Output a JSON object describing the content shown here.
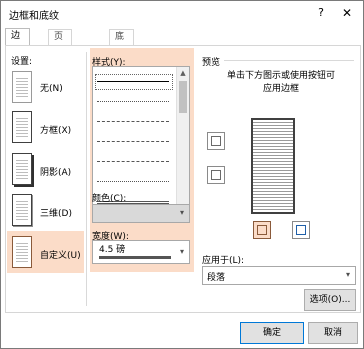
{
  "title": "边框和底纹",
  "titlebar": {
    "help_label": "?",
    "close_label": "✕"
  },
  "tabs": [
    {
      "label": "边框(B)"
    },
    {
      "label": "页面边框(P)"
    },
    {
      "label": "底纹(S)"
    }
  ],
  "setting": {
    "label": "设置:",
    "items": [
      {
        "label": "无(N)"
      },
      {
        "label": "方框(X)"
      },
      {
        "label": "阴影(A)"
      },
      {
        "label": "三维(D)"
      },
      {
        "label": "自定义(U)"
      }
    ]
  },
  "style": {
    "label": "样式(Y):"
  },
  "color": {
    "label": "颜色(C):",
    "value": ""
  },
  "width": {
    "label": "宽度(W):",
    "value": "4.5 磅"
  },
  "preview": {
    "label": "预览",
    "instruction": "单击下方图示或使用按钮可\n应用边框"
  },
  "apply_to": {
    "label": "应用于(L):",
    "value": "段落"
  },
  "options_button": "选项(O)...",
  "ok_button": "确定",
  "cancel_button": "取消"
}
